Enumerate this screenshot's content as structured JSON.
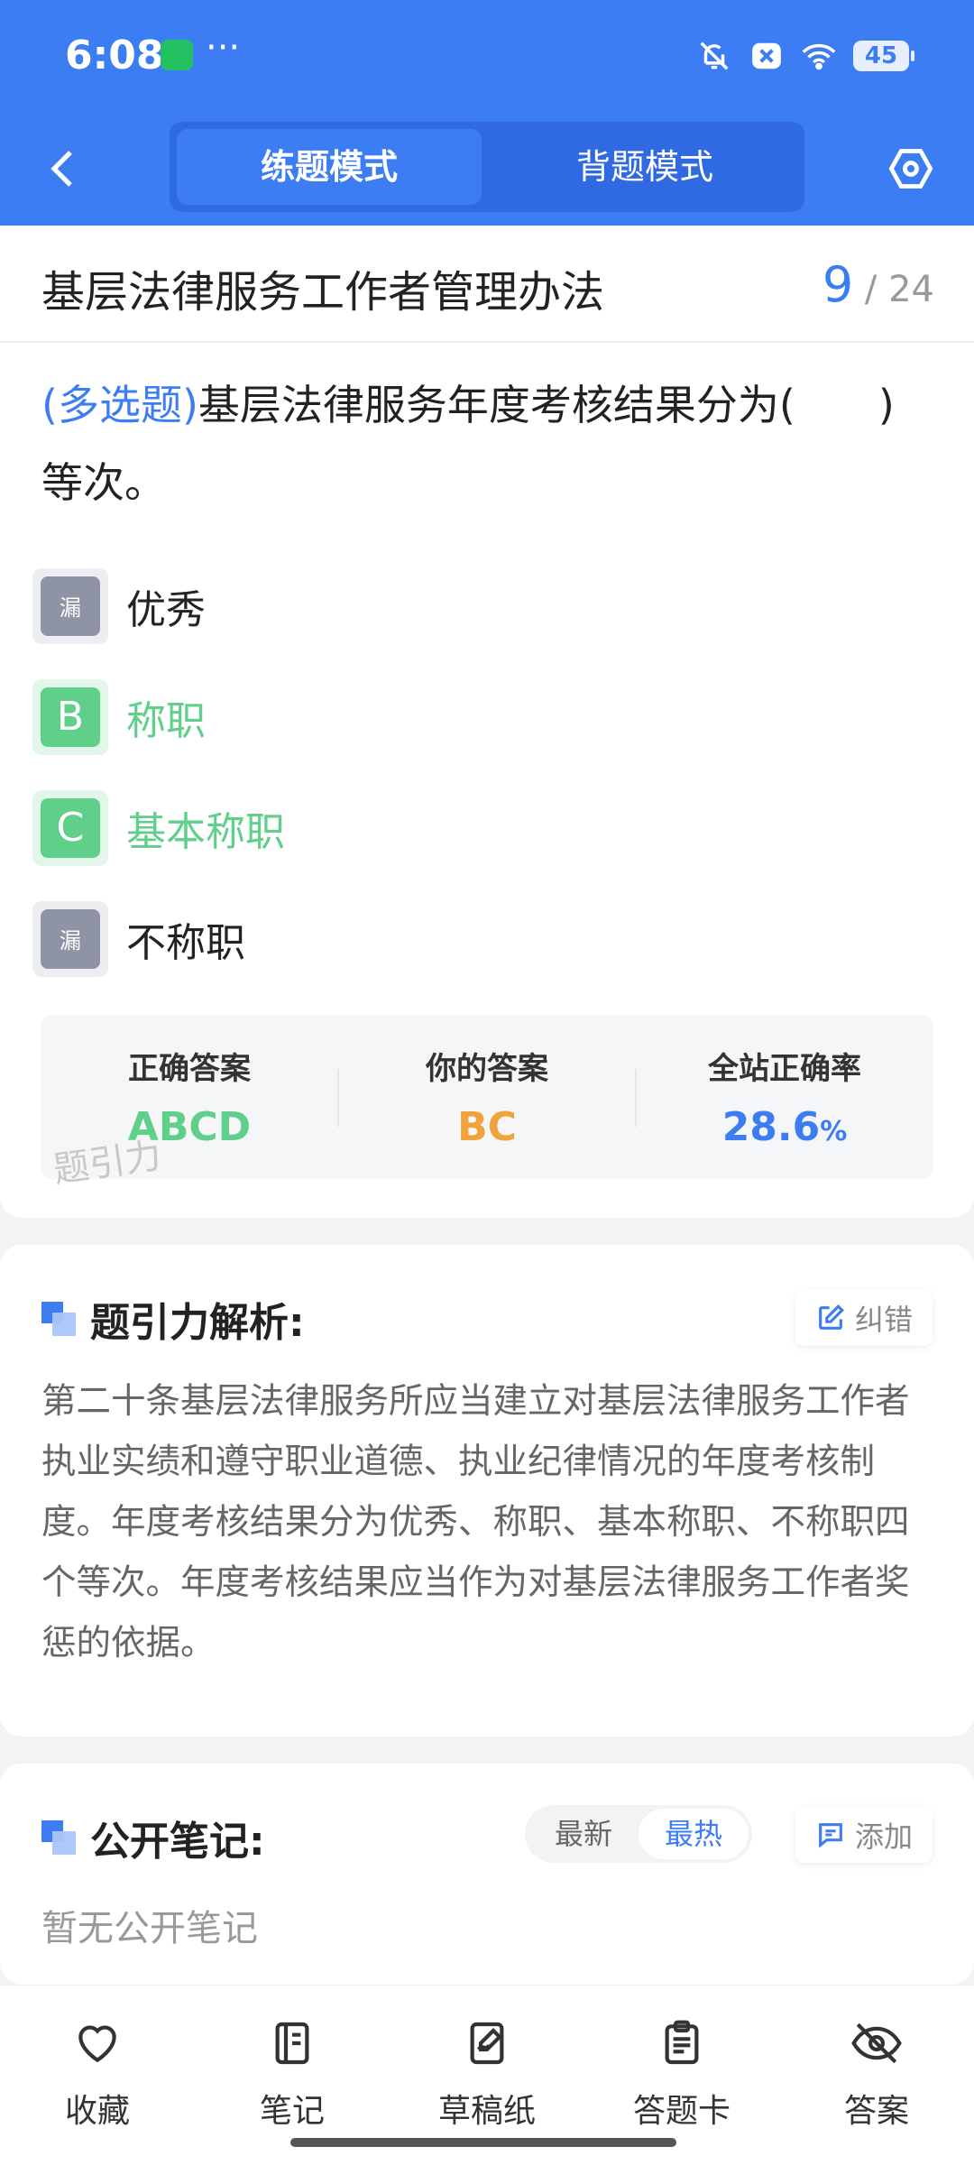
{
  "status_bar": {
    "time": "6:08",
    "more": "···",
    "battery": "45"
  },
  "header": {
    "modes": [
      "练题模式",
      "背题模式"
    ],
    "active_mode": "练题模式"
  },
  "title_bar": {
    "title": "基层法律服务工作者管理办法",
    "page_current": "9",
    "page_total": "/ 24"
  },
  "question": {
    "type": "(多选题)",
    "text": "基层法律服务年度考核结果分为(　　)等次。",
    "options": [
      {
        "badge": "漏",
        "text": "优秀",
        "state": "missed"
      },
      {
        "badge": "B",
        "text": "称职",
        "state": "correct"
      },
      {
        "badge": "C",
        "text": "基本称职",
        "state": "correct"
      },
      {
        "badge": "漏",
        "text": "不称职",
        "state": "missed"
      }
    ]
  },
  "stats": {
    "correct_label": "正确答案",
    "correct_value": "ABCD",
    "yours_label": "你的答案",
    "yours_value": "BC",
    "rate_label": "全站正确率",
    "rate_value": "28.6",
    "rate_unit": "%"
  },
  "watermark": "题引力",
  "analysis": {
    "title": "题引力解析:",
    "correct_button": "纠错",
    "body": "第二十条基层法律服务所应当建立对基层法律服务工作者执业实绩和遵守职业道德、执业纪律情况的年度考核制度。年度考核结果分为优秀、称职、基本称职、不称职四个等次。年度考核结果应当作为对基层法律服务工作者奖惩的依据。"
  },
  "notes": {
    "title": "公开笔记:",
    "sort_latest": "最新",
    "sort_hot": "最热",
    "add_button": "添加",
    "empty": "暂无公开笔记"
  },
  "bottom_nav": [
    {
      "label": "收藏",
      "icon": "heart-icon"
    },
    {
      "label": "笔记",
      "icon": "notebook-icon"
    },
    {
      "label": "草稿纸",
      "icon": "draft-icon"
    },
    {
      "label": "答题卡",
      "icon": "answer-sheet-icon"
    },
    {
      "label": "答案",
      "icon": "eye-off-icon"
    }
  ],
  "colors": {
    "primary": "#3d7df3",
    "correct": "#5fcf8a",
    "user": "#f0a23b",
    "missed": "#8e93a5"
  }
}
